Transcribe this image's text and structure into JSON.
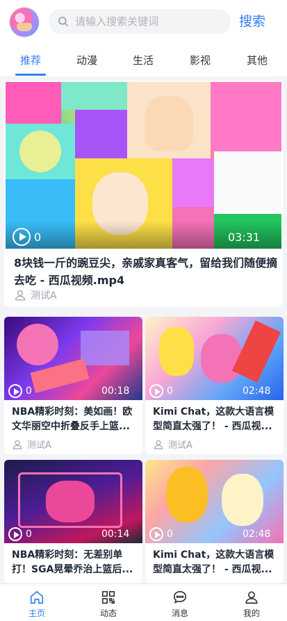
{
  "header": {
    "search_placeholder": "请输入搜索关键词",
    "search_button": "搜索"
  },
  "tabs": [
    {
      "label": "推荐",
      "active": true
    },
    {
      "label": "动漫",
      "active": false
    },
    {
      "label": "生活",
      "active": false
    },
    {
      "label": "影视",
      "active": false
    },
    {
      "label": "其他",
      "active": false
    }
  ],
  "featured": {
    "views": "0",
    "duration": "03:31",
    "title": "8块钱一斤的豌豆尖，亲戚家真客气，留给我们随便摘去吃 - 西瓜视频.mp4",
    "author": "测试A"
  },
  "cards": [
    {
      "views": "0",
      "duration": "00:18",
      "title": "NBA精彩时刻：美如画！欧文华丽空中折叠反手上篮...",
      "author": "测试A"
    },
    {
      "views": "0",
      "duration": "02:48",
      "title": "Kimi Chat，这款大语言模型简直太强了！ - 西瓜视...",
      "author": "测试A"
    },
    {
      "views": "0",
      "duration": "00:14",
      "title": "NBA精彩时刻：无差别单打！SGA晃晕乔治上篮后..."
    },
    {
      "views": "0",
      "duration": "02:48",
      "title": "Kimi Chat，这款大语言模型简直太强了！ - 西瓜视..."
    }
  ],
  "bottom_nav": [
    {
      "label": "主页",
      "icon": "home-icon",
      "active": true
    },
    {
      "label": "动态",
      "icon": "qrcode-icon",
      "active": false
    },
    {
      "label": "消息",
      "icon": "message-icon",
      "active": false
    },
    {
      "label": "我的",
      "icon": "user-icon",
      "active": false
    }
  ],
  "colors": {
    "accent": "#2f7df6",
    "text": "#1f2937",
    "muted": "#9ca3af"
  }
}
